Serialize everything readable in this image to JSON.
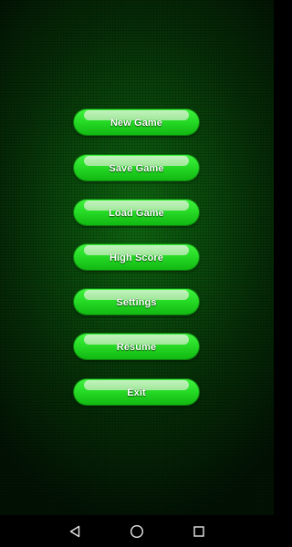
{
  "menu": {
    "items": [
      {
        "label": "New Game"
      },
      {
        "label": "Save Game"
      },
      {
        "label": "Load Game"
      },
      {
        "label": "High Score"
      },
      {
        "label": "Settings"
      },
      {
        "label": "Resume"
      },
      {
        "label": "Exit"
      }
    ]
  },
  "navbar": {
    "back": {
      "icon": "triangle-back-icon"
    },
    "home": {
      "icon": "circle-home-icon"
    },
    "recents": {
      "icon": "square-recents-icon"
    }
  },
  "colors": {
    "button_green": "#27dc27",
    "button_highlight": "#c9f3c4",
    "background_green": "#0a4d0c",
    "navbar": "#000000"
  }
}
